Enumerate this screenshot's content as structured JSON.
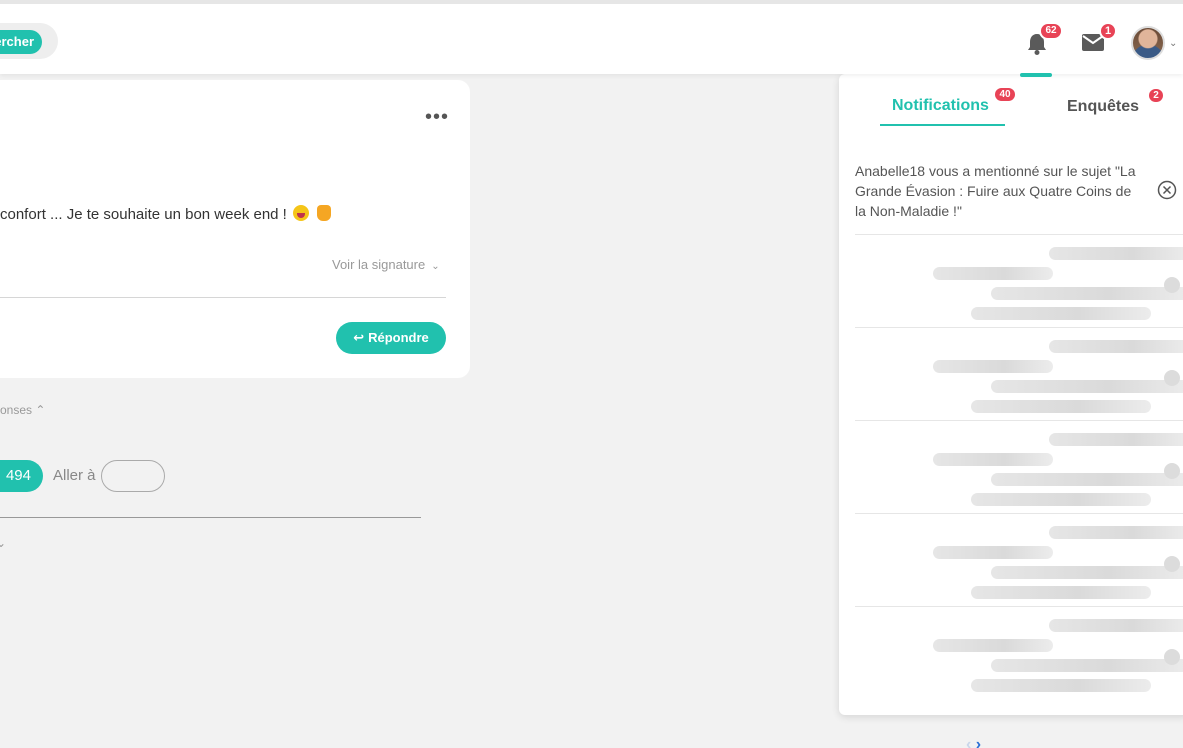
{
  "header": {
    "search_label": "ercher",
    "notifications_badge": "62",
    "messages_badge": "1"
  },
  "post": {
    "text": "confort ... Je te souhaite un bon week end !",
    "signature_link": "Voir la signature",
    "reply_label": "Répondre"
  },
  "thread": {
    "responses_toggle": "onses",
    "current_page": "494",
    "goto_label": "Aller à"
  },
  "notifications_panel": {
    "tabs": [
      {
        "label": "Notifications",
        "badge": "40"
      },
      {
        "label": "Enquêtes",
        "badge": "2"
      }
    ],
    "items": [
      {
        "text": "Anabelle18 vous a mentionné sur le sujet \"La Grande Évasion : Fuire aux Quatre Coins de la Non-Maladie !\""
      }
    ]
  },
  "colors": {
    "accent": "#21c1ae",
    "badge": "#e84356"
  }
}
